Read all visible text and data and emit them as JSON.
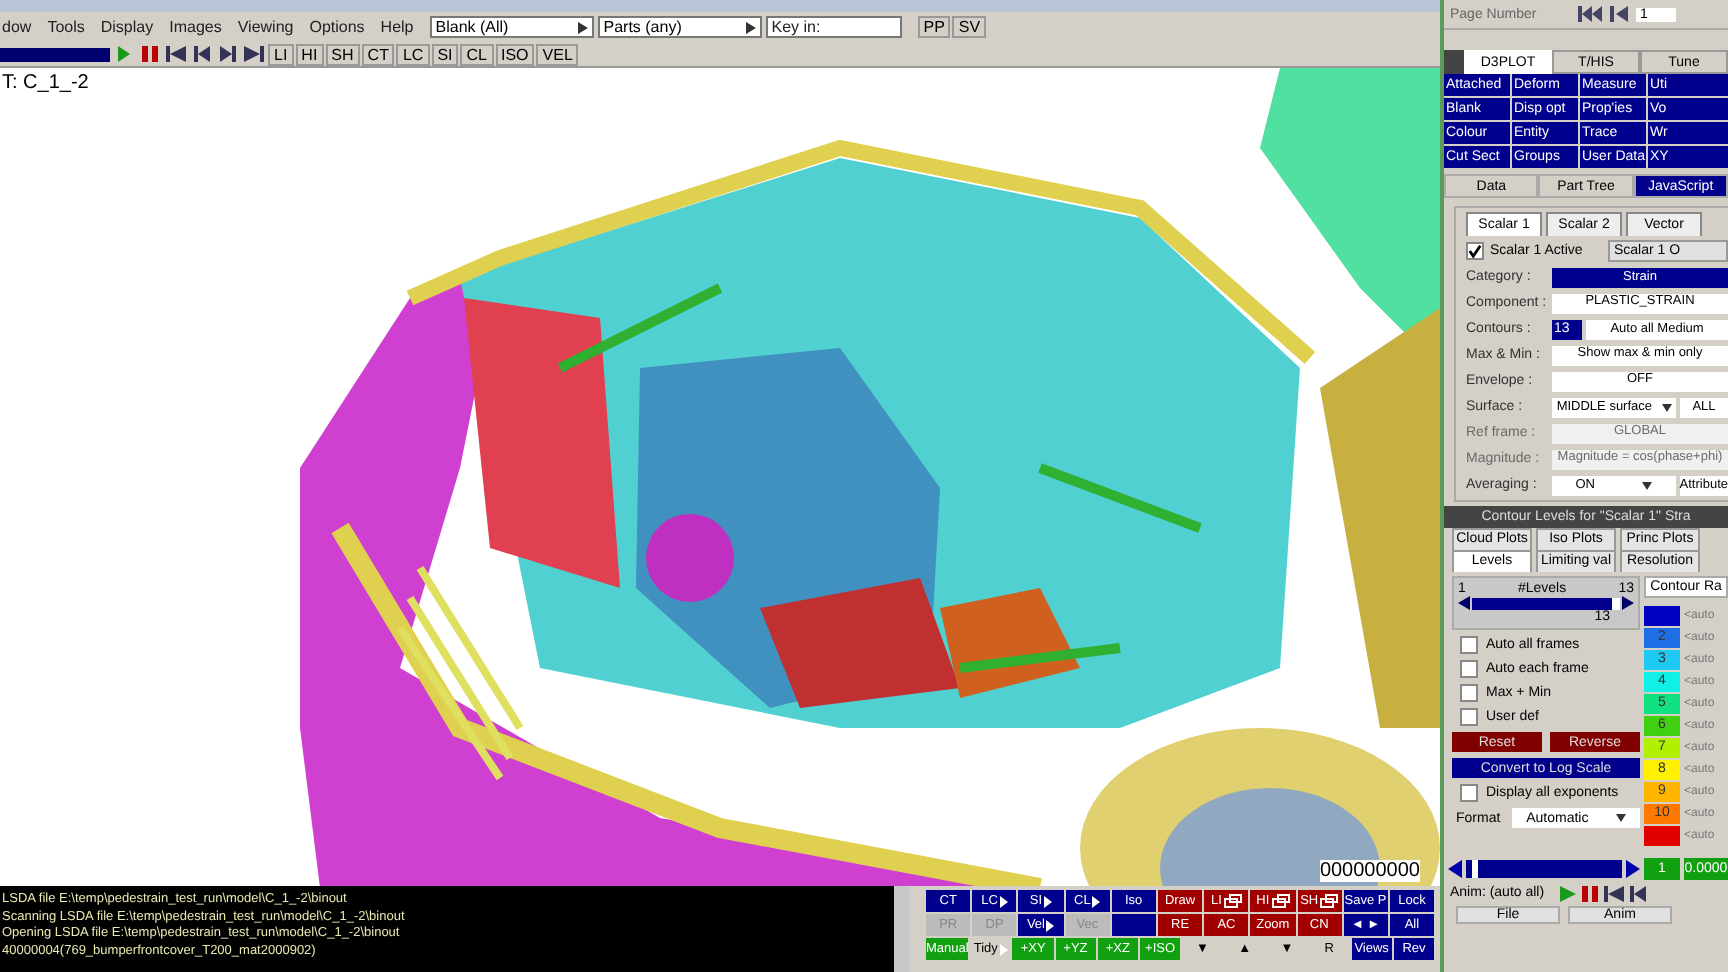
{
  "menu": [
    "dow",
    "Tools",
    "Display",
    "Images",
    "Viewing",
    "Options",
    "Help"
  ],
  "selectors": [
    {
      "value": "Blank (All)"
    },
    {
      "value": "Parts (any)"
    }
  ],
  "key_field": {
    "placeholder": "Key in:"
  },
  "top_buttons": [
    "PP",
    "SV"
  ],
  "toolbar": {
    "progress": {
      "level": 1
    },
    "buttons": [
      "LI",
      "HI",
      "SH",
      "CT",
      "LC",
      "SI",
      "CL",
      "ISO",
      "VEL"
    ]
  },
  "viewport": {
    "title": "T: C_1_-2",
    "counter": "000000000"
  },
  "log": [
    "LSDA file E:\\temp\\pedestrain_test_run\\model\\C_1_-2\\binout",
    "Scanning LSDA file E:\\temp\\pedestrain_test_run\\model\\C_1_-2\\binout",
    "Opening LSDA file E:\\temp\\pedestrain_test_run\\model\\C_1_-2\\binout",
    "40000004(769_bumperfrontcover_T200_mat2000902)"
  ],
  "controls": [
    [
      {
        "label": "CT",
        "kind": "blue"
      },
      {
        "label": "LC",
        "kind": "blue",
        "menu": true
      },
      {
        "label": "SI",
        "kind": "blue",
        "menu": true
      },
      {
        "label": "CL",
        "kind": "blue",
        "menu": true
      },
      {
        "label": "Iso",
        "kind": "blue"
      },
      {
        "label": "Draw",
        "kind": "red"
      },
      {
        "label": "LI",
        "kind": "red",
        "icon": true
      },
      {
        "label": "HI",
        "kind": "red",
        "icon": true
      },
      {
        "label": "SH",
        "kind": "red",
        "icon": true
      },
      {
        "label": "Save P",
        "kind": "blue"
      },
      {
        "label": "Lock",
        "kind": "blue"
      }
    ],
    [
      {
        "label": "PR",
        "kind": "gray"
      },
      {
        "label": "DP",
        "kind": "gray"
      },
      {
        "label": "Vel",
        "kind": "blue",
        "menu": true
      },
      {
        "label": "Vec",
        "kind": "gray"
      },
      {
        "kind": "blue"
      },
      {
        "label": "RE",
        "kind": "red"
      },
      {
        "label": "AC",
        "kind": "red"
      },
      {
        "label": "Zoom",
        "kind": "red"
      },
      {
        "label": "CN",
        "kind": "red"
      },
      {
        "label": "◄ ►",
        "kind": "blue"
      },
      {
        "label": "All",
        "kind": "blue"
      }
    ],
    [
      {
        "label": "Manual",
        "kind": "green"
      },
      {
        "label": "Tidy",
        "kind": "light",
        "menu": true
      },
      {
        "label": "+XY",
        "kind": "green"
      },
      {
        "label": "+YZ",
        "kind": "green"
      },
      {
        "label": "+XZ",
        "kind": "green"
      },
      {
        "label": "+ISO",
        "kind": "green"
      },
      {
        "label": "▼",
        "kind": "light"
      },
      {
        "label": "▲",
        "kind": "light"
      },
      {
        "label": "▼",
        "kind": "light"
      },
      {
        "label": "R",
        "kind": "light"
      },
      {
        "label": "Views",
        "kind": "blue"
      },
      {
        "label": "Rev",
        "kind": "blue"
      }
    ]
  ],
  "right_panel": {
    "page_label": "Page Number",
    "page": "1",
    "tabs": [
      {
        "label": "D3PLOT",
        "selected": true
      },
      {
        "label": "T/HIS",
        "selected": false
      },
      {
        "label": "Tune",
        "selected": false
      }
    ],
    "functions": [
      "Attached",
      "Deform",
      "Measure",
      "Uti",
      "Blank",
      "Disp opt",
      "Prop'ies",
      "Vo",
      "Colour",
      "Entity",
      "Trace",
      "Wr",
      "Cut Sect",
      "Groups",
      "User Data",
      "XY"
    ],
    "data_tabs": [
      {
        "label": "Data",
        "selected": false
      },
      {
        "label": "Part Tree",
        "selected": false
      },
      {
        "label": "JavaScript",
        "selected": true
      }
    ],
    "scalar_tabs": [
      {
        "label": "Scalar 1",
        "selected": true
      },
      {
        "label": "Scalar 2",
        "selected": false
      },
      {
        "label": "Vector",
        "selected": false
      }
    ],
    "scalar_active": {
      "label": "Scalar 1 Active",
      "checked": true
    },
    "scalar_options": "Scalar 1 O",
    "form": [
      {
        "label": "Category :",
        "kind": "choice",
        "value": "Strain",
        "disabled": false
      },
      {
        "label": "Component :",
        "kind": "text",
        "value": "PLASTIC_STRAIN",
        "disabled": false
      },
      {
        "label": "Contours :",
        "kind": "pair",
        "value": "13",
        "button": "Auto all Medium",
        "disabled": false
      },
      {
        "label": "Max & Min :",
        "kind": "text",
        "value": "Show max & min only",
        "disabled": false
      },
      {
        "label": "Envelope :",
        "kind": "text",
        "value": "OFF",
        "disabled": false
      },
      {
        "label": "Surface :",
        "kind": "dropdown",
        "value": "MIDDLE surface",
        "button": "ALL",
        "disabled": false
      },
      {
        "label": "Ref frame :",
        "kind": "text",
        "value": "GLOBAL",
        "disabled": true
      },
      {
        "label": "Magnitude :",
        "kind": "text",
        "value": "Magnitude = cos(phase+phi)",
        "disabled": true
      },
      {
        "label": "Averaging :",
        "kind": "dropdown",
        "value": "ON",
        "button": "Attribute",
        "disabled": false
      }
    ],
    "contour_header": "Contour Levels for \"Scalar 1\" Stra",
    "sub_tabs_back": [
      {
        "label": "Cloud Plots",
        "selected": false
      },
      {
        "label": "Iso Plots",
        "selected": false
      },
      {
        "label": "Princ Plots",
        "selected": false
      }
    ],
    "sub_tabs": [
      {
        "label": "Levels",
        "selected": true
      },
      {
        "label": "Limiting val",
        "selected": false
      },
      {
        "label": "Resolution",
        "selected": false
      }
    ],
    "levels": {
      "min": "1",
      "title": "#Levels",
      "max": "13",
      "level": 0.95,
      "value": "13"
    },
    "options": [
      {
        "label": "Auto all frames",
        "checked": false
      },
      {
        "label": "Auto each frame",
        "checked": false
      },
      {
        "label": "Max + Min",
        "checked": false
      },
      {
        "label": "User def",
        "checked": false
      }
    ],
    "reset": "Reset",
    "reverse": "Reverse",
    "log_scale": "Convert to Log Scale",
    "exponents": {
      "label": "Display all exponents",
      "checked": false
    },
    "format_label": "Format",
    "format": "Automatic",
    "range_button": "Contour Ra",
    "scale": [
      {
        "color": "#0000c0",
        "value": "<auto"
      },
      {
        "color": "#1e6ee6",
        "number": "2",
        "value": "<auto"
      },
      {
        "color": "#1ec8f0",
        "number": "3",
        "value": "<auto"
      },
      {
        "color": "#10f0e6",
        "number": "4",
        "value": "<auto"
      },
      {
        "color": "#10e080",
        "number": "5",
        "value": "<auto"
      },
      {
        "color": "#40d010",
        "number": "6",
        "value": "<auto"
      },
      {
        "color": "#b0f000",
        "number": "7",
        "value": "<auto"
      },
      {
        "color": "#fff000",
        "number": "8",
        "value": "<auto"
      },
      {
        "color": "#ffb400",
        "number": "9",
        "value": "<auto"
      },
      {
        "color": "#ff7800",
        "number": "10",
        "value": "<auto"
      },
      {
        "color": "#e00000",
        "value": "<auto"
      }
    ],
    "anim": {
      "level": 0.04,
      "frame": "1",
      "time": "0.0000",
      "label": "Anim: (auto all)",
      "menus": [
        "File",
        "Anim"
      ]
    }
  }
}
